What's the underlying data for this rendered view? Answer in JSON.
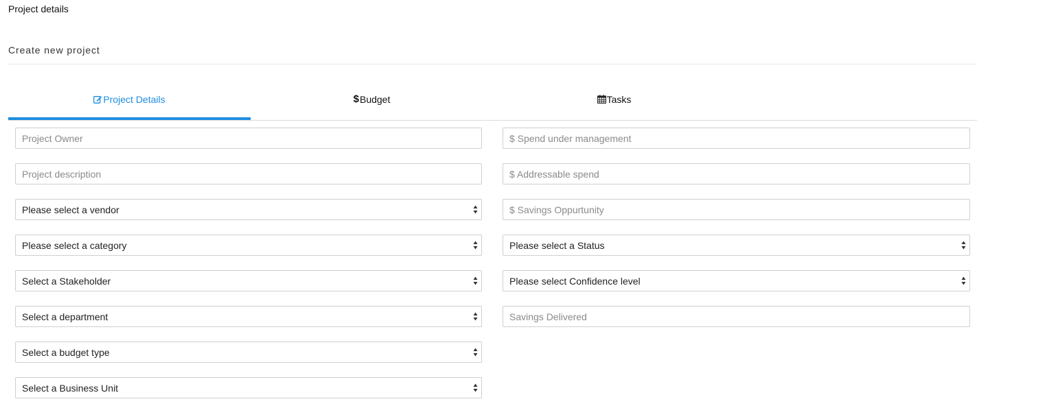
{
  "page": {
    "title": "Project details",
    "subtitle": "Create new project"
  },
  "tabs": [
    {
      "label": "Project Details",
      "icon": "edit-icon",
      "active": true
    },
    {
      "label": "Budget",
      "icon": "dollar-icon",
      "active": false
    },
    {
      "label": "Tasks",
      "icon": "calendar-icon",
      "active": false
    }
  ],
  "accent_color": "#1e8ee0",
  "left_fields": {
    "project_owner": {
      "placeholder": "Project Owner"
    },
    "project_description": {
      "placeholder": "Project description"
    },
    "vendor": {
      "selected": "Please select a vendor"
    },
    "category": {
      "selected": "Please select a category"
    },
    "stakeholder": {
      "selected": "Select a Stakeholder"
    },
    "department": {
      "selected": "Select a department"
    },
    "budget_type": {
      "selected": "Select a budget type"
    },
    "business_unit": {
      "selected": "Select a Business Unit"
    }
  },
  "right_fields": {
    "spend_under_management": {
      "placeholder": "$ Spend under management"
    },
    "addressable_spend": {
      "placeholder": "$ Addressable spend"
    },
    "savings_opportunity": {
      "placeholder": "$ Savings Oppurtunity"
    },
    "status": {
      "selected": "Please select a Status"
    },
    "confidence_level": {
      "selected": "Please select Confidence level"
    },
    "savings_delivered": {
      "placeholder": "Savings Delivered"
    }
  }
}
